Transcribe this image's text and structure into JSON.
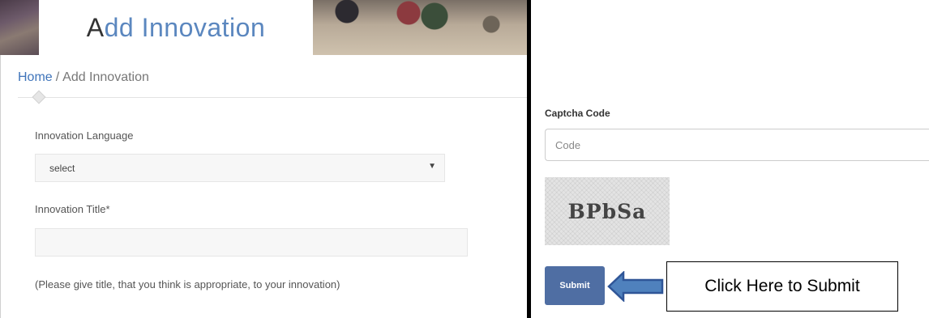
{
  "banner": {
    "title_first_letter": "A",
    "title_rest": "dd Innovation"
  },
  "breadcrumb": {
    "home": "Home",
    "separator": "/",
    "current": "Add Innovation"
  },
  "form": {
    "language_label": "Innovation Language",
    "language_selected": "select",
    "title_label": "Innovation Title*",
    "title_value": "",
    "title_help": "(Please give title, that you think is appropriate, to your innovation)"
  },
  "captcha": {
    "label": "Captcha Code",
    "placeholder": "Code",
    "image_text": "BPbSa"
  },
  "submit": {
    "label": "Submit"
  },
  "callout": {
    "text": "Click Here to Submit",
    "arrow_color": "#4f81bd",
    "arrow_border_color": "#2f5597"
  },
  "colors": {
    "accent": "#5b87bf",
    "link": "#3f74ba",
    "button": "#4f6ea3"
  }
}
